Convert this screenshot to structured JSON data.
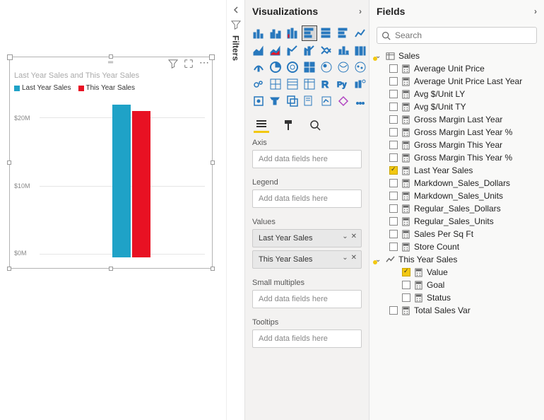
{
  "canvas": {
    "chart_title": "Last Year Sales and This Year Sales",
    "legend": [
      {
        "label": "Last Year Sales",
        "color": "#1fa2c7"
      },
      {
        "label": "This Year Sales",
        "color": "#e81123"
      }
    ]
  },
  "chart_data": {
    "type": "bar",
    "title": "Last Year Sales and This Year Sales",
    "categories": [
      ""
    ],
    "series": [
      {
        "name": "Last Year Sales",
        "values": [
          23000000
        ],
        "color": "#1fa2c7"
      },
      {
        "name": "This Year Sales",
        "values": [
          22000000
        ],
        "color": "#e81123"
      }
    ],
    "ylabel": "",
    "ylim": [
      0,
      24000000
    ],
    "yticks": [
      {
        "v": 0,
        "label": "$0M"
      },
      {
        "v": 10000000,
        "label": "$10M"
      },
      {
        "v": 20000000,
        "label": "$20M"
      }
    ]
  },
  "filters_label": "Filters",
  "viz_pane": {
    "title": "Visualizations",
    "wells": {
      "axis": {
        "label": "Axis",
        "placeholder": "Add data fields here"
      },
      "legend": {
        "label": "Legend",
        "placeholder": "Add data fields here"
      },
      "values": {
        "label": "Values",
        "items": [
          "Last Year Sales",
          "This Year Sales"
        ]
      },
      "small": {
        "label": "Small multiples",
        "placeholder": "Add data fields here"
      },
      "tooltips": {
        "label": "Tooltips",
        "placeholder": "Add data fields here"
      }
    }
  },
  "fields_pane": {
    "title": "Fields",
    "search_placeholder": "Search",
    "tables": [
      {
        "name": "Sales",
        "expanded": true,
        "highlighted": true,
        "fields": [
          {
            "name": "Average Unit Price",
            "checked": false
          },
          {
            "name": "Average Unit Price Last Year",
            "checked": false
          },
          {
            "name": "Avg $/Unit LY",
            "checked": false
          },
          {
            "name": "Avg $/Unit TY",
            "checked": false
          },
          {
            "name": "Gross Margin Last Year",
            "checked": false
          },
          {
            "name": "Gross Margin Last Year %",
            "checked": false
          },
          {
            "name": "Gross Margin This Year",
            "checked": false
          },
          {
            "name": "Gross Margin This Year %",
            "checked": false
          },
          {
            "name": "Last Year Sales",
            "checked": true
          },
          {
            "name": "Markdown_Sales_Dollars",
            "checked": false
          },
          {
            "name": "Markdown_Sales_Units",
            "checked": false
          },
          {
            "name": "Regular_Sales_Dollars",
            "checked": false
          },
          {
            "name": "Regular_Sales_Units",
            "checked": false
          },
          {
            "name": "Sales Per Sq Ft",
            "checked": false
          },
          {
            "name": "Store Count",
            "checked": false
          }
        ]
      },
      {
        "name": "This Year Sales",
        "expanded": true,
        "highlighted": true,
        "kpi": true,
        "fields": [
          {
            "name": "Value",
            "checked": true
          },
          {
            "name": "Goal",
            "checked": false
          },
          {
            "name": "Status",
            "checked": false
          }
        ]
      },
      {
        "name_only": "Total Sales Var",
        "is_field": true
      }
    ]
  }
}
